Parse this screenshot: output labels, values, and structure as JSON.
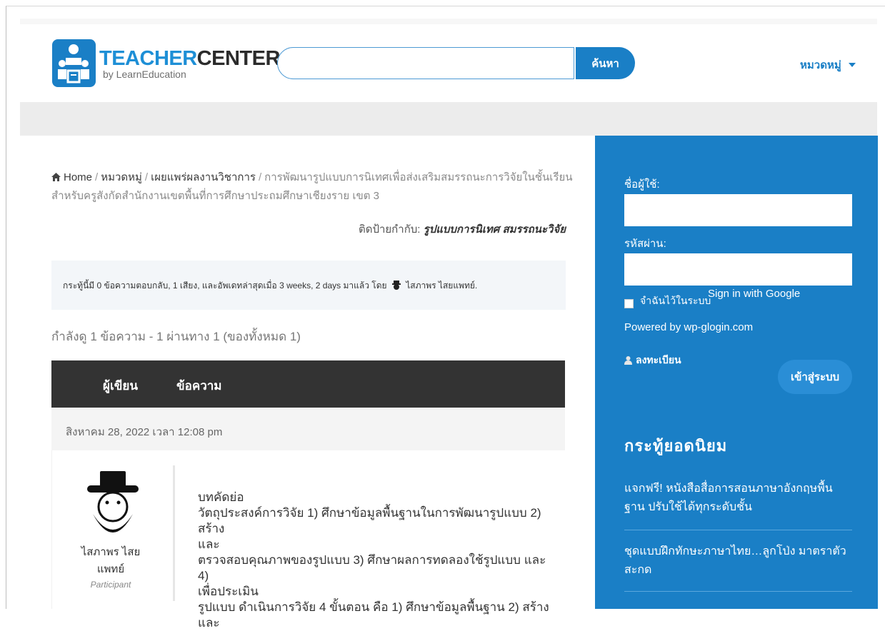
{
  "header": {
    "logo_title_part1": "TEACHER",
    "logo_title_part2": "CENTER",
    "logo_subtitle": "by LearnEducation",
    "search_placeholder": "",
    "search_button": "ค้นหา",
    "category_menu": "หมวดหมู่"
  },
  "breadcrumb": {
    "home": "Home",
    "category": "หมวดหมู่",
    "forum": "เผยแพร่ผลงานวิชาการ",
    "current": "การพัฒนารูปแบบการนิเทศเพื่อส่งเสริมสมรรถนะการวิจัยในชั้นเรียน สำหรับครูสังกัดสำนักงานเขตพื้นที่การศึกษาประถมศึกษาเชียงราย เขต 3"
  },
  "tags": {
    "label": "ติดป้ายกำกับ:",
    "values": "รูปแบบการนิเทศ สมรรถนะวิจัย"
  },
  "topic_info": {
    "text_before": "กระทู้นี้มี 0 ข้อความตอบกลับ, 1 เสียง, และอัพเดทล่าสุดเมื่อ 3 weeks, 2 days มาแล้ว โดย",
    "author": "ไสภาพร ไสยแพทย์."
  },
  "viewing": "กำลังดู 1 ข้อความ - 1 ผ่านทาง 1 (ของทั้งหมด 1)",
  "table": {
    "col_author": "ผู้เขียน",
    "col_post": "ข้อความ"
  },
  "post": {
    "date": "สิงหาคม 28, 2022 เวลา 12:08 pm",
    "author_name": "ไสภาพร ไสยแพทย์",
    "author_role": "Participant",
    "lines": [
      "บทคัดย่อ",
      "วัตถุประสงค์การวิจัย 1) ศึกษาข้อมูลพื้นฐานในการพัฒนารูปแบบ 2) สร้าง",
      "และ",
      "ตรวจสอบคุณภาพของรูปแบบ 3) ศึกษาผลการทดลองใช้รูปแบบ และ 4)",
      "เพื่อประเมิน",
      "รูปแบบ ดำเนินการวิจัย 4 ขั้นตอน คือ 1) ศึกษาข้อมูลพื้นฐาน 2) สร้างและ"
    ]
  },
  "sidebar": {
    "username_label": "ชื่อผู้ใช้:",
    "password_label": "รหัสผ่าน:",
    "remember_label": "จำฉันไว้ในระบบ",
    "google_signin": "Sign in with Google",
    "powered_by": "Powered by wp-glogin.com",
    "register": "ลงทะเบียน",
    "login_button": "เข้าสู่ระบบ",
    "popular_title": "กระทู้ยอดนิยม",
    "popular_items": [
      "แจกฟรี! หนังสือสื่อการสอนภาษาอังกฤษพื้นฐาน ปรับใช้ได้ทุกระดับชั้น",
      "ชุดแบบฝึกทักษะภาษาไทย…ลูกโป่ง มาตราตัวสะกด"
    ]
  },
  "colors": {
    "brand_blue": "#1a7fc6",
    "table_header": "#333333"
  }
}
